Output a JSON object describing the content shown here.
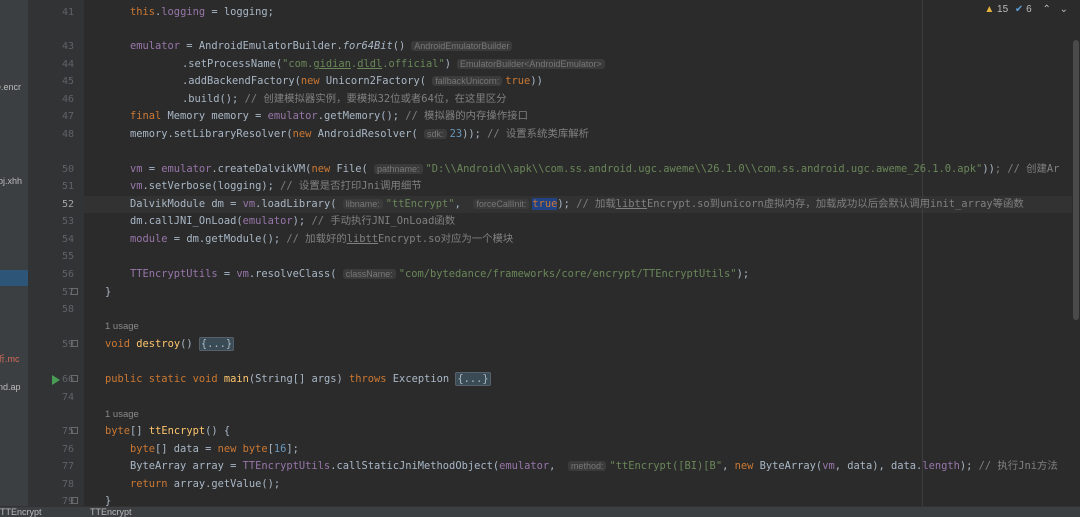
{
  "badges": {
    "warnings": "15",
    "checks": "6"
  },
  "left_panel": {
    "items": [
      {
        "label": "e.encr"
      },
      {
        "label": "bj.xhh"
      },
      {
        "label": "析.mc"
      },
      {
        "label": "nd.ap"
      }
    ]
  },
  "lines": {
    "41": "41",
    "43": "43",
    "44": "44",
    "45": "45",
    "46": "46",
    "47": "47",
    "48": "48",
    "50": "50",
    "51": "51",
    "52": "52",
    "53": "53",
    "54": "54",
    "55": "55",
    "56": "56",
    "57": "57",
    "58": "58",
    "59": "59",
    "66": "66",
    "74": "74",
    "75": "75",
    "76": "76",
    "77": "77",
    "78": "78",
    "79": "79"
  },
  "usage_label": "1 usage",
  "hints": {
    "builder_type": "AndroidEmulatorBuilder",
    "builder_generic": "EmulatorBuilder<AndroidEmulator>",
    "fallback": "fallbackUnicorn:",
    "sdk": "sdk:",
    "pathname": "pathname:",
    "libname": "libname:",
    "force": "forceCallInit:",
    "classname": "className:",
    "method": "method:"
  },
  "comments": {
    "c46": "// 创建模拟器实例，要模拟32位或者64位，在这里区分",
    "c47": "// 模拟器的内存操作接口",
    "c48": "// 设置系统类库解析",
    "c50": "; // 创建Ar",
    "c51": "// 设置是否打印Jni调用细节",
    "c52": "// 加载libttEncrypt.so到unicorn虚拟内存，加载成功以后会默认调用init_array等函数",
    "c53": "// 手动执行JNI_OnLoad函数",
    "c54": "// 加载好的libttEncrypt.so对应为一个模块",
    "c77": "// 执行Jni方法"
  },
  "strings": {
    "process": "\"com.gidian.dldl.official\"",
    "path": "\"D:\\\\Android\\\\apk\\\\com.ss.android.ugc.aweme\\\\26.1.0\\\\com.ss.android.ugc.aweme_26.1.0.apk\"",
    "lib": "\"ttEncrypt\"",
    "cls": "\"com/bytedance/frameworks/core/encrypt/TTEncryptUtils\"",
    "sig": "\"ttEncrypt([BI)[B\""
  },
  "bottom_tabs": [
    "TTEncrypt",
    "TTEncrypt"
  ]
}
